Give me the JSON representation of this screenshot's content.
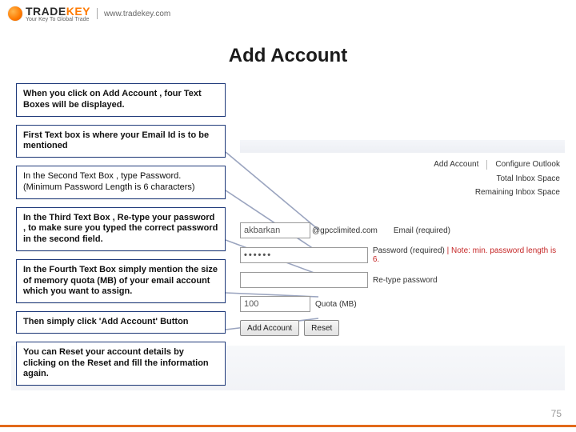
{
  "logo": {
    "brand_part1": "TRADE",
    "brand_part2": "KEY",
    "tagline": "Your Key To Global Trade",
    "url": "www.tradekey.com"
  },
  "title": "Add Account",
  "steps": [
    "When you click on Add Account , four Text Boxes will be displayed.",
    "First Text box is where your Email Id is to be mentioned",
    "In the Second Text Box , type Password. (Minimum Password Length is 6 characters)",
    "In the Third Text Box , Re-type your password , to make sure you typed the correct password in the second field.",
    "In  the Fourth Text Box simply mention the size of memory quota (MB) of your email account which you want to assign.",
    "Then simply click 'Add Account' Button",
    "You can Reset your account details by clicking on the Reset and fill the information again."
  ],
  "pane": {
    "tab_add_account": "Add Account",
    "tab_configure": "Configure Outlook",
    "link_total_space": "Total Inbox Space",
    "link_remaining_space": "Remaining Inbox Space"
  },
  "form": {
    "email_value": "akbarkan",
    "email_domain": "@gpcclimited.com",
    "email_label": "Email (required)",
    "password_value": "••••••",
    "password_label": "Password (required) ",
    "password_hint": "| Note: min. password length is 6.",
    "retype_label": "Re-type password",
    "quota_value": "100",
    "quota_label": "Quota (MB)",
    "btn_add": "Add Account",
    "btn_reset": "Reset"
  },
  "page_number": "75"
}
